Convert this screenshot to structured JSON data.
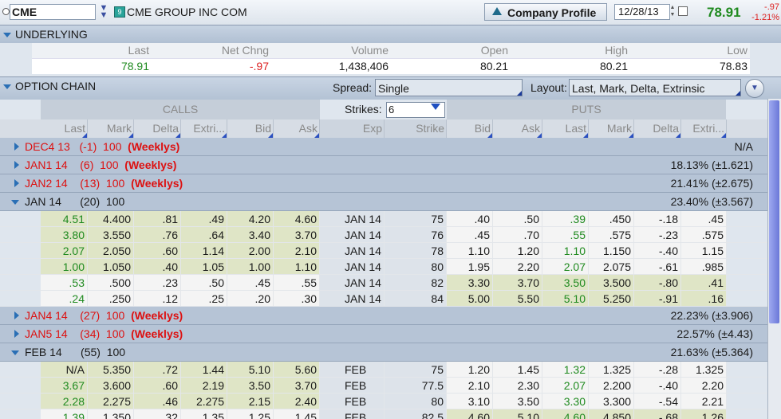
{
  "header": {
    "symbol": "CME",
    "symbol_badge": "9",
    "company_name": "CME GROUP INC COM",
    "profile_button": "Company Profile",
    "date": "12/28/13",
    "last": "78.91",
    "net_change": "-.97",
    "pct_change": "-1.21%"
  },
  "underlying": {
    "title": "UNDERLYING",
    "headers": [
      "Last",
      "Net Chng",
      "Volume",
      "Open",
      "High",
      "Low"
    ],
    "values": [
      "78.91",
      "-.97",
      "1,438,406",
      "80.21",
      "80.21",
      "78.83"
    ]
  },
  "option_chain": {
    "title": "OPTION CHAIN",
    "spread_label": "Spread:",
    "spread_value": "Single",
    "layout_label": "Layout:",
    "layout_value": "Last, Mark, Delta, Extrinsic",
    "calls_label": "CALLS",
    "puts_label": "PUTS",
    "strikes_label": "Strikes:",
    "strikes_value": "6",
    "columns": [
      "Last",
      "Mark",
      "Delta",
      "Extri...",
      "Bid",
      "Ask",
      "Exp",
      "Strike",
      "Bid",
      "Ask",
      "Last",
      "Mark",
      "Delta",
      "Extri..."
    ]
  },
  "groups": [
    {
      "label": "DEC4 13   (-1)  100  (Weeklys)",
      "right": "N/A",
      "red": true,
      "open": false,
      "rows": []
    },
    {
      "label": "JAN1 14    (6)  100  (Weeklys)",
      "right": "18.13% (±1.621)",
      "red": true,
      "open": false,
      "rows": []
    },
    {
      "label": "JAN2 14    (13)  100  (Weeklys)",
      "right": "21.41% (±2.675)",
      "red": true,
      "open": false,
      "rows": []
    },
    {
      "label": "JAN 14      (20)  100",
      "right": "23.40% (±3.567)",
      "red": false,
      "open": true,
      "rows": [
        [
          "4.51",
          "4.400",
          ".81",
          ".49",
          "4.20",
          "4.60",
          "JAN 14",
          "75",
          ".40",
          ".50",
          ".39",
          ".450",
          "-.18",
          ".45"
        ],
        [
          "3.80",
          "3.550",
          ".76",
          ".64",
          "3.40",
          "3.70",
          "JAN 14",
          "76",
          ".45",
          ".70",
          ".55",
          ".575",
          "-.23",
          ".575"
        ],
        [
          "2.07",
          "2.050",
          ".60",
          "1.14",
          "2.00",
          "2.10",
          "JAN 14",
          "78",
          "1.10",
          "1.20",
          "1.10",
          "1.150",
          "-.40",
          "1.15"
        ],
        [
          "1.00",
          "1.050",
          ".40",
          "1.05",
          "1.00",
          "1.10",
          "JAN 14",
          "80",
          "1.95",
          "2.20",
          "2.07",
          "2.075",
          "-.61",
          ".985"
        ],
        [
          ".53",
          ".500",
          ".23",
          ".50",
          ".45",
          ".55",
          "JAN 14",
          "82",
          "3.30",
          "3.70",
          "3.50",
          "3.500",
          "-.80",
          ".41"
        ],
        [
          ".24",
          ".250",
          ".12",
          ".25",
          ".20",
          ".30",
          "JAN 14",
          "84",
          "5.00",
          "5.50",
          "5.10",
          "5.250",
          "-.91",
          ".16"
        ]
      ],
      "itm_calls": 4
    },
    {
      "label": "JAN4 14    (27)  100  (Weeklys)",
      "right": "22.23% (±3.906)",
      "red": true,
      "open": false,
      "rows": []
    },
    {
      "label": "JAN5 14    (34)  100  (Weeklys)",
      "right": "22.57% (±4.43)",
      "red": true,
      "open": false,
      "rows": []
    },
    {
      "label": "FEB 14      (55)  100",
      "right": "21.63% (±5.364)",
      "red": false,
      "open": true,
      "rows": [
        [
          "N/A",
          "5.350",
          ".72",
          "1.44",
          "5.10",
          "5.60",
          "FEB 14",
          "75",
          "1.20",
          "1.45",
          "1.32",
          "1.325",
          "-.28",
          "1.325"
        ],
        [
          "3.67",
          "3.600",
          ".60",
          "2.19",
          "3.50",
          "3.70",
          "FEB 14",
          "77.5",
          "2.10",
          "2.30",
          "2.07",
          "2.200",
          "-.40",
          "2.20"
        ],
        [
          "2.28",
          "2.275",
          ".46",
          "2.275",
          "2.15",
          "2.40",
          "FEB 14",
          "80",
          "3.10",
          "3.50",
          "3.30",
          "3.300",
          "-.54",
          "2.21"
        ],
        [
          "1.39",
          "1.350",
          ".32",
          "1.35",
          "1.25",
          "1.45",
          "FEB 14",
          "82.5",
          "4.60",
          "5.10",
          "4.60",
          "4.850",
          "-.68",
          "1.26"
        ]
      ],
      "itm_calls": 3
    }
  ]
}
